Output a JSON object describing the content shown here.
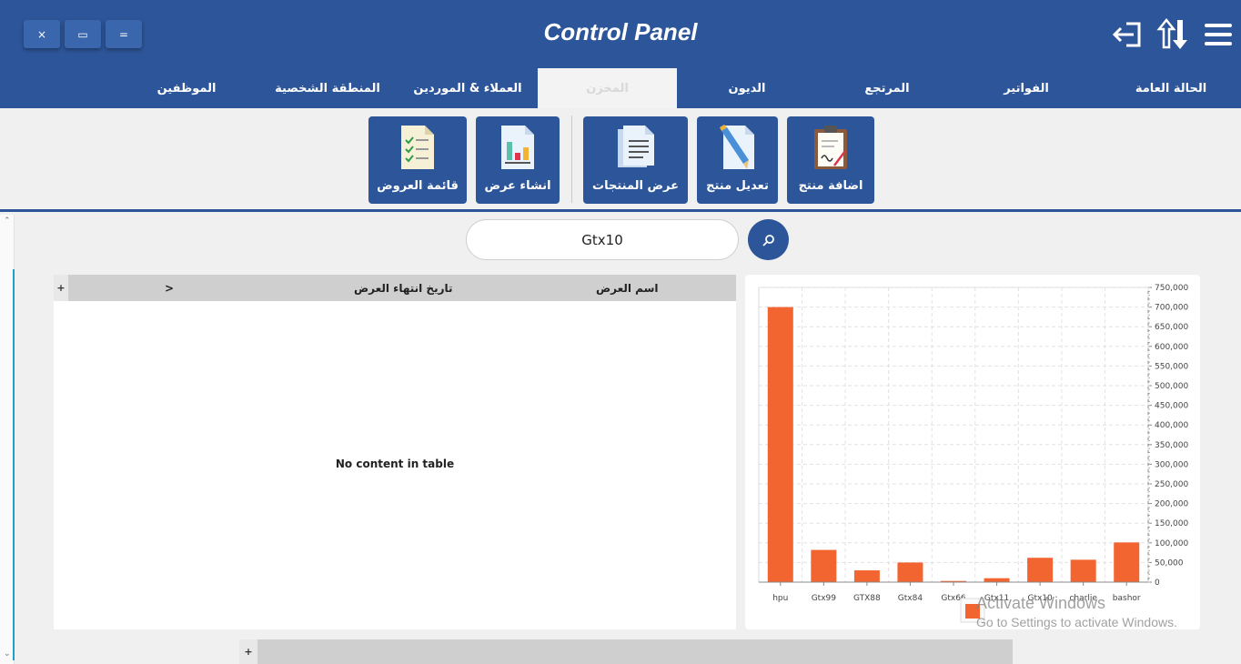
{
  "window": {
    "title": "Control Panel",
    "controls": {
      "close": "×",
      "restore": "▭",
      "minimize": "="
    }
  },
  "top_icons": [
    "logout-icon",
    "sort-icon",
    "menu-icon"
  ],
  "tabs": [
    {
      "label": "الحالة العامة",
      "active": false
    },
    {
      "label": "الفواتير",
      "active": false
    },
    {
      "label": "المرتجع",
      "active": false
    },
    {
      "label": "الديون",
      "active": false
    },
    {
      "label": "المخزن",
      "active": true
    },
    {
      "label": "العملاء & الموردين",
      "active": false
    },
    {
      "label": "المنطقة الشخصية",
      "active": false
    },
    {
      "label": "الموظفين",
      "active": false
    }
  ],
  "toolbar": {
    "add_product": "اضافة منتج",
    "edit_product": "تعديل منتج",
    "view_products": "عرض المنتجات",
    "create_offer": "انشاء عرض",
    "offers_list": "قائمة العروض"
  },
  "search": {
    "value": "Gtx10"
  },
  "table": {
    "plus": "+",
    "columns": [
      "اسم العرض",
      "تاريخ انتهاء العرض",
      ">"
    ],
    "empty_message": "No content in table"
  },
  "bottom_bar": {
    "plus": "+"
  },
  "colors": {
    "primary": "#2d5599",
    "bar": "#f26430",
    "accent": "#1da1c8"
  },
  "chart_data": {
    "type": "bar",
    "categories": [
      "hpu",
      "Gtx99",
      "GTX88",
      "Gtx84",
      "Gtx66",
      "Gtx11",
      "Gtx10",
      "charlie",
      "bashor"
    ],
    "values": [
      700000,
      82000,
      30000,
      50000,
      3000,
      10000,
      62000,
      57000,
      101000
    ],
    "ylim": [
      0,
      750000
    ],
    "y_ticks": [
      "0",
      "50,000",
      "100,000",
      "150,000",
      "200,000",
      "250,000",
      "300,000",
      "350,000",
      "400,000",
      "450,000",
      "500,000",
      "550,000",
      "600,000",
      "650,000",
      "700,000",
      "750,000"
    ],
    "grid": true,
    "y_axis_side": "right",
    "legend": "bottom"
  },
  "watermark": {
    "line1": "Activate Windows",
    "line2": "Go to Settings to activate Windows."
  }
}
